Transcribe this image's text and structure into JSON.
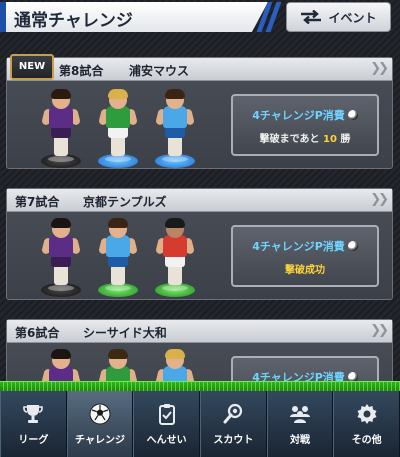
{
  "header": {
    "title": "通常チャレンジ",
    "event_button_label": "イベント"
  },
  "matches": [
    {
      "badge": "NEW",
      "match_no": "第8試合",
      "team": "浦安マウス",
      "button_title": "4チャレンジP消費",
      "status_prefix": "撃破まであと",
      "status_count": "10",
      "status_suffix": "勝"
    },
    {
      "match_no": "第7試合",
      "team": "京都テンプルズ",
      "button_title": "4チャレンジP消費",
      "status": "撃破成功"
    },
    {
      "match_no": "第6試合",
      "team": "シーサイド大和",
      "button_title": "4チャレンジP消費"
    }
  ],
  "nav": {
    "items": [
      {
        "label": "リーグ",
        "icon": "trophy-icon"
      },
      {
        "label": "チャレンジ",
        "icon": "soccer-ball-icon",
        "active": true
      },
      {
        "label": "へんせい",
        "icon": "clipboard-icon"
      },
      {
        "label": "スカウト",
        "icon": "magnifier-icon"
      },
      {
        "label": "対戦",
        "icon": "team-icon"
      },
      {
        "label": "その他",
        "icon": "gear-icon"
      }
    ]
  },
  "colors": {
    "accent_blue": "#6fd3ff",
    "highlight_yellow": "#ffd23a",
    "grass_green": "#2fb21d"
  }
}
